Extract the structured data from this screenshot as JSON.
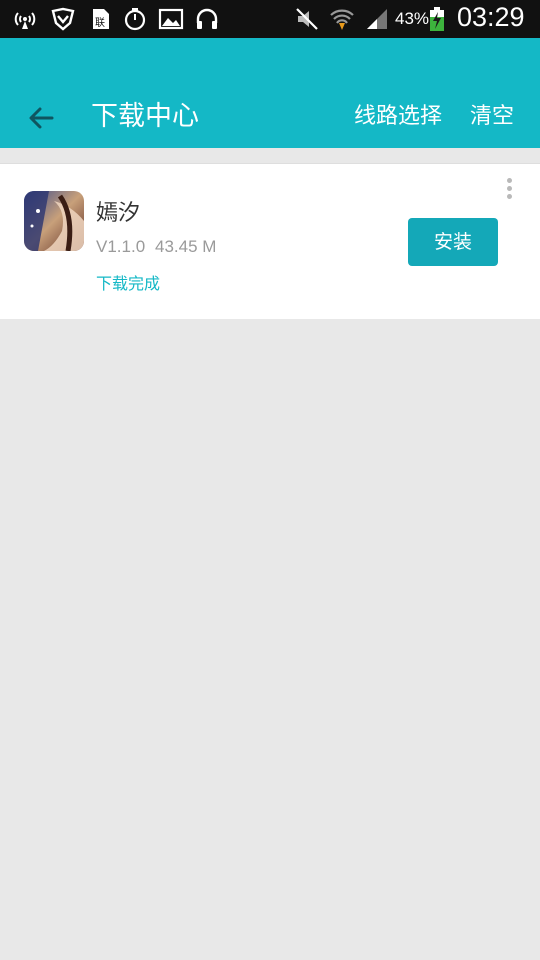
{
  "status_bar": {
    "battery_percent": "43%",
    "time": "03:29",
    "icons": [
      "signal-wave-icon",
      "vpn-shield-icon",
      "sim-card-icon",
      "stopwatch-icon",
      "image-icon",
      "headphones-icon",
      "mute-icon",
      "wifi-icon",
      "cell-signal-icon",
      "battery-charging-icon"
    ]
  },
  "app_bar": {
    "back_icon": "back-arrow-icon",
    "title": "下载中心",
    "action_route": "线路选择",
    "action_clear": "清空",
    "color": "#14b8c6"
  },
  "download_item": {
    "name": "嫣汐",
    "version": "V1.1.0",
    "size": "43.45 M",
    "status": "下载完成",
    "install_label": "安装",
    "more_icon": "more-vertical-icon",
    "accent": "#14a8b8"
  }
}
